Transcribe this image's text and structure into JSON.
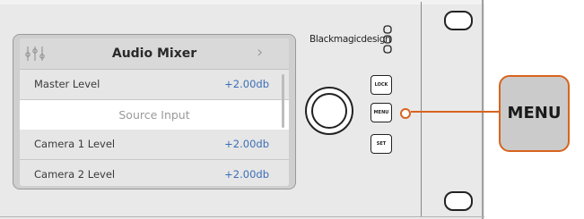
{
  "screen": {
    "title": "Audio Mixer",
    "header_icon": "mixer-sliders-icon",
    "rows": [
      {
        "label": "Master Level",
        "value": "+2.00db"
      },
      {
        "section": "Source Input"
      },
      {
        "label": "Camera 1 Level",
        "value": "+2.00db"
      },
      {
        "label": "Camera 2 Level",
        "value": "+2.00db"
      }
    ]
  },
  "device": {
    "brand": "Blackmagicdesign",
    "buttons": {
      "lock": "LOCK",
      "menu": "MENU",
      "set": "SET"
    }
  },
  "callout": {
    "label": "MENU"
  },
  "colors": {
    "accent": "#d8641e",
    "value_blue": "#3b6fb6"
  }
}
